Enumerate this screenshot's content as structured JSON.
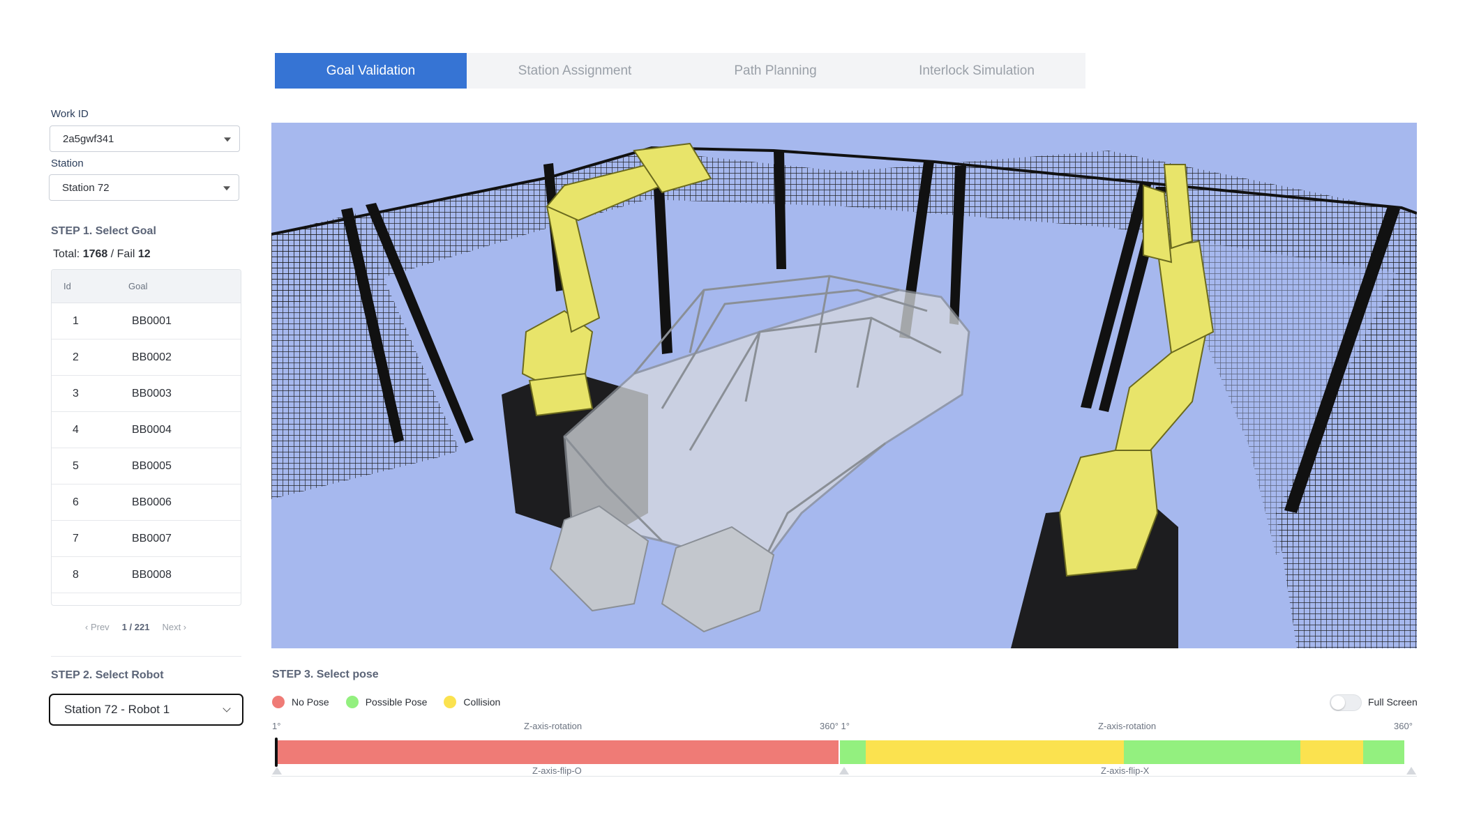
{
  "tabs": [
    {
      "label": "Goal Validation",
      "active": true
    },
    {
      "label": "Station Assignment",
      "active": false
    },
    {
      "label": "Path Planning",
      "active": false
    },
    {
      "label": "Interlock Simulation",
      "active": false
    }
  ],
  "left": {
    "work_id_label": "Work ID",
    "work_id_value": "2a5gwf341",
    "station_label": "Station",
    "station_value": "Station 72",
    "step1_title": "STEP 1. Select Goal",
    "total_label": "Total:",
    "total_value": "1768",
    "fail_label": "/ Fail",
    "fail_value": "12",
    "table": {
      "headers": [
        "Id",
        "Goal"
      ],
      "rows": [
        {
          "id": "1",
          "goal": "BB0001"
        },
        {
          "id": "2",
          "goal": "BB0002"
        },
        {
          "id": "3",
          "goal": "BB0003"
        },
        {
          "id": "4",
          "goal": "BB0004"
        },
        {
          "id": "5",
          "goal": "BB0005"
        },
        {
          "id": "6",
          "goal": "BB0006"
        },
        {
          "id": "7",
          "goal": "BB0007"
        },
        {
          "id": "8",
          "goal": "BB0008"
        }
      ]
    },
    "pager": {
      "prev": "Prev",
      "page": "1 / 221",
      "next": "Next"
    },
    "step2_title": "STEP 2. Select Robot",
    "robot_value": "Station 72 - Robot 1"
  },
  "step3": {
    "title": "STEP 3. Select pose",
    "legend": [
      {
        "label": "No Pose",
        "color": "#ef7b76"
      },
      {
        "label": "Possible Pose",
        "color": "#93f07f"
      },
      {
        "label": "Collision",
        "color": "#fbe24f"
      }
    ],
    "full_screen_label": "Full Screen",
    "full_screen_on": false,
    "axis": {
      "start_1": "1°",
      "title_1": "Z-axis-rotation",
      "end_1": "360° 1°",
      "title_2": "Z-axis-rotation",
      "end_2": "360°",
      "flip_1": "Z-axis-flip-O",
      "flip_2": "Z-axis-flip-X"
    },
    "bar_segments": [
      {
        "from_deg": 1,
        "to_deg": 360,
        "flip": "Z-axis-flip-O",
        "status": "No Pose",
        "color": "#ef7b76"
      },
      {
        "from_deg": 1,
        "to_deg": 18,
        "flip": "Z-axis-flip-X",
        "status": "Possible Pose",
        "color": "#93f07f"
      },
      {
        "from_deg": 18,
        "to_deg": 182,
        "flip": "Z-axis-flip-X",
        "status": "Collision",
        "color": "#fbe24f"
      },
      {
        "from_deg": 182,
        "to_deg": 294,
        "flip": "Z-axis-flip-X",
        "status": "Possible Pose",
        "color": "#93f07f"
      },
      {
        "from_deg": 294,
        "to_deg": 334,
        "flip": "Z-axis-flip-X",
        "status": "Collision",
        "color": "#fbe24f"
      },
      {
        "from_deg": 334,
        "to_deg": 360,
        "flip": "Z-axis-flip-X",
        "status": "Possible Pose",
        "color": "#93f07f"
      }
    ]
  },
  "colors": {
    "accent": "#3674d4",
    "viewport_floor": "#a6b8ee",
    "robot": "#e8e46a"
  }
}
